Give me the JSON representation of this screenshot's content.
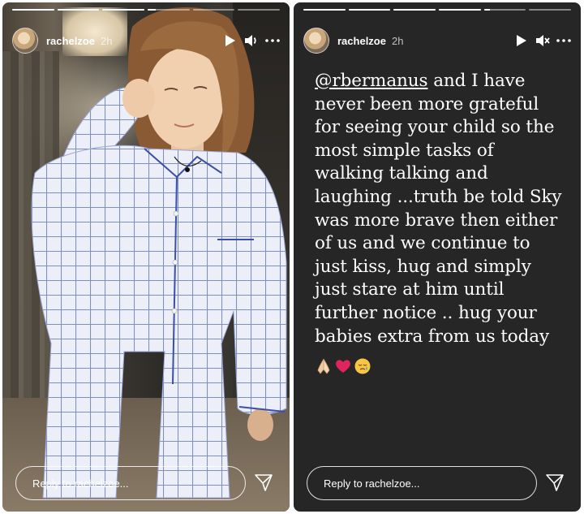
{
  "stories": [
    {
      "username": "rachelzoe",
      "time": "2h",
      "reply_placeholder": "Reply to rachelzoe...",
      "progress": [
        1,
        1,
        1,
        0.2,
        0,
        0
      ],
      "muted": false
    },
    {
      "username": "rachelzoe",
      "time": "2h",
      "reply_placeholder": "Reply to rachelzoe...",
      "progress": [
        1,
        1,
        1,
        1,
        0.15,
        0
      ],
      "muted": true,
      "caption": {
        "mention": "@rbermanus",
        "lines": [
          " and I have",
          "never been more grateful",
          "for seeing your child so the",
          "most simple tasks of",
          "walking talking and",
          "laughing ...truth be told Sky",
          "was more brave then either",
          "of us and we continue to",
          "just kiss, hug and simply",
          "just stare at him until",
          "further notice .. hug your",
          "babies extra from us today"
        ],
        "emojis": [
          "folded-hands",
          "red-heart",
          "sleepy-face"
        ]
      }
    }
  ],
  "colors": {
    "story_background": "#262626",
    "text": "#ffffff",
    "heart": "#e0245e",
    "emoji_yellow": "#f7c744"
  }
}
